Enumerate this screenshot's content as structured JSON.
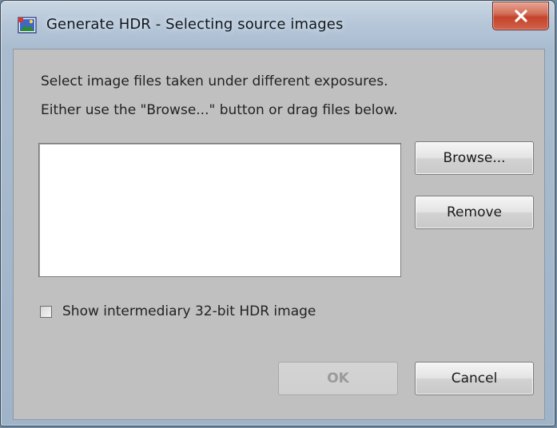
{
  "window": {
    "title": "Generate HDR - Selecting source images"
  },
  "icons": {
    "app": "hdr-image-icon",
    "close": "close-x-icon"
  },
  "dialog": {
    "instruction_1": "Select image files taken under different exposures.",
    "instruction_2": "Either use the \"Browse...\" button or drag files below.",
    "file_list": [],
    "browse_label": "Browse...",
    "remove_label": "Remove",
    "checkbox_label": "Show intermediary 32-bit HDR image",
    "checkbox_checked": false,
    "ok_label": "OK",
    "ok_enabled": false,
    "cancel_label": "Cancel"
  },
  "colors": {
    "dialog_background": "#c0c0c0",
    "close_button": "#c4442b",
    "disabled_text": "#9a9a9a"
  }
}
